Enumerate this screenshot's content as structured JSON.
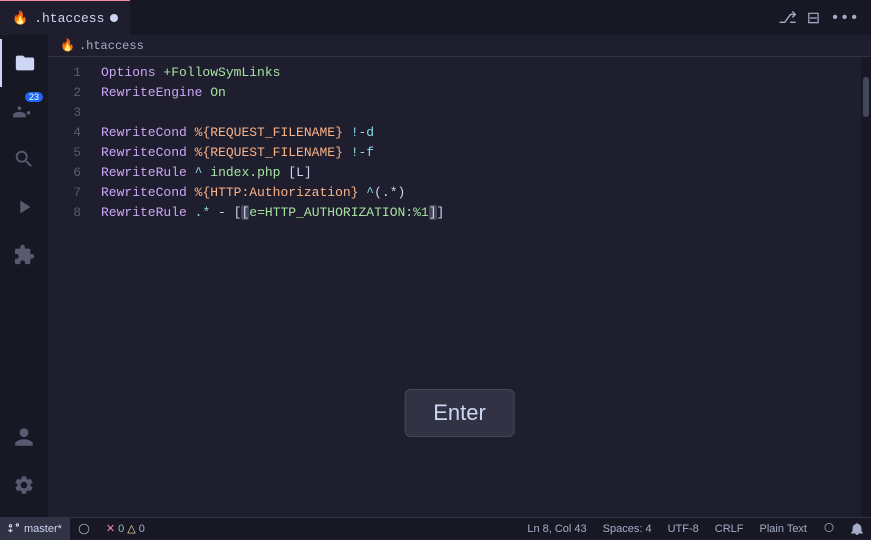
{
  "tab": {
    "icon": "🔥",
    "filename": ".htaccess",
    "modified": true
  },
  "breadcrumb": {
    "icon": "🔥",
    "path": ".htaccess"
  },
  "editor": {
    "lines": [
      {
        "num": 1,
        "tokens": [
          {
            "text": "Options +FollowSymLinks",
            "class": ""
          }
        ]
      },
      {
        "num": 2,
        "tokens": [
          {
            "text": "RewriteEngine On",
            "class": ""
          }
        ]
      },
      {
        "num": 3,
        "tokens": [
          {
            "text": "",
            "class": ""
          }
        ]
      },
      {
        "num": 4,
        "tokens": [
          {
            "text": "RewriteCond %{REQUEST_FILENAME} !-d",
            "class": ""
          }
        ]
      },
      {
        "num": 5,
        "tokens": [
          {
            "text": "RewriteCond %{REQUEST_FILENAME} !-f",
            "class": ""
          }
        ]
      },
      {
        "num": 6,
        "tokens": [
          {
            "text": "RewriteRule ^ index.php [L]",
            "class": ""
          }
        ]
      },
      {
        "num": 7,
        "tokens": [
          {
            "text": "RewriteCond %{HTTP:Authorization} ^(.*)",
            "class": ""
          }
        ]
      },
      {
        "num": 8,
        "tokens": [
          {
            "text": "RewriteRule .* - [e=HTTP_AUTHORIZATION:%1]",
            "class": ""
          }
        ]
      }
    ]
  },
  "enter_key_label": "Enter",
  "status": {
    "branch": "master*",
    "sync_icon": "⟳",
    "errors": "0",
    "warnings": "0",
    "position": "Ln 8, Col 43",
    "spaces": "Spaces: 4",
    "encoding": "UTF-8",
    "line_ending": "CRLF",
    "language": "Plain Text",
    "remote_icon": "⬆",
    "bell_icon": "🔔"
  },
  "activity": {
    "items": [
      {
        "name": "files-icon",
        "icon": "⊞",
        "active": true,
        "badge": ""
      },
      {
        "name": "source-control-icon",
        "icon": "⎇",
        "active": false,
        "badge": "23"
      },
      {
        "name": "extensions-icon",
        "icon": "⊛",
        "active": false,
        "badge": ""
      },
      {
        "name": "search-icon",
        "icon": "🔍",
        "active": false,
        "badge": ""
      },
      {
        "name": "run-icon",
        "icon": "▷",
        "active": false,
        "badge": ""
      },
      {
        "name": "extensions2-icon",
        "icon": "⧉",
        "active": false,
        "badge": ""
      }
    ],
    "bottom": [
      {
        "name": "account-icon",
        "icon": "👤"
      },
      {
        "name": "settings-icon",
        "icon": "⚙"
      }
    ]
  }
}
